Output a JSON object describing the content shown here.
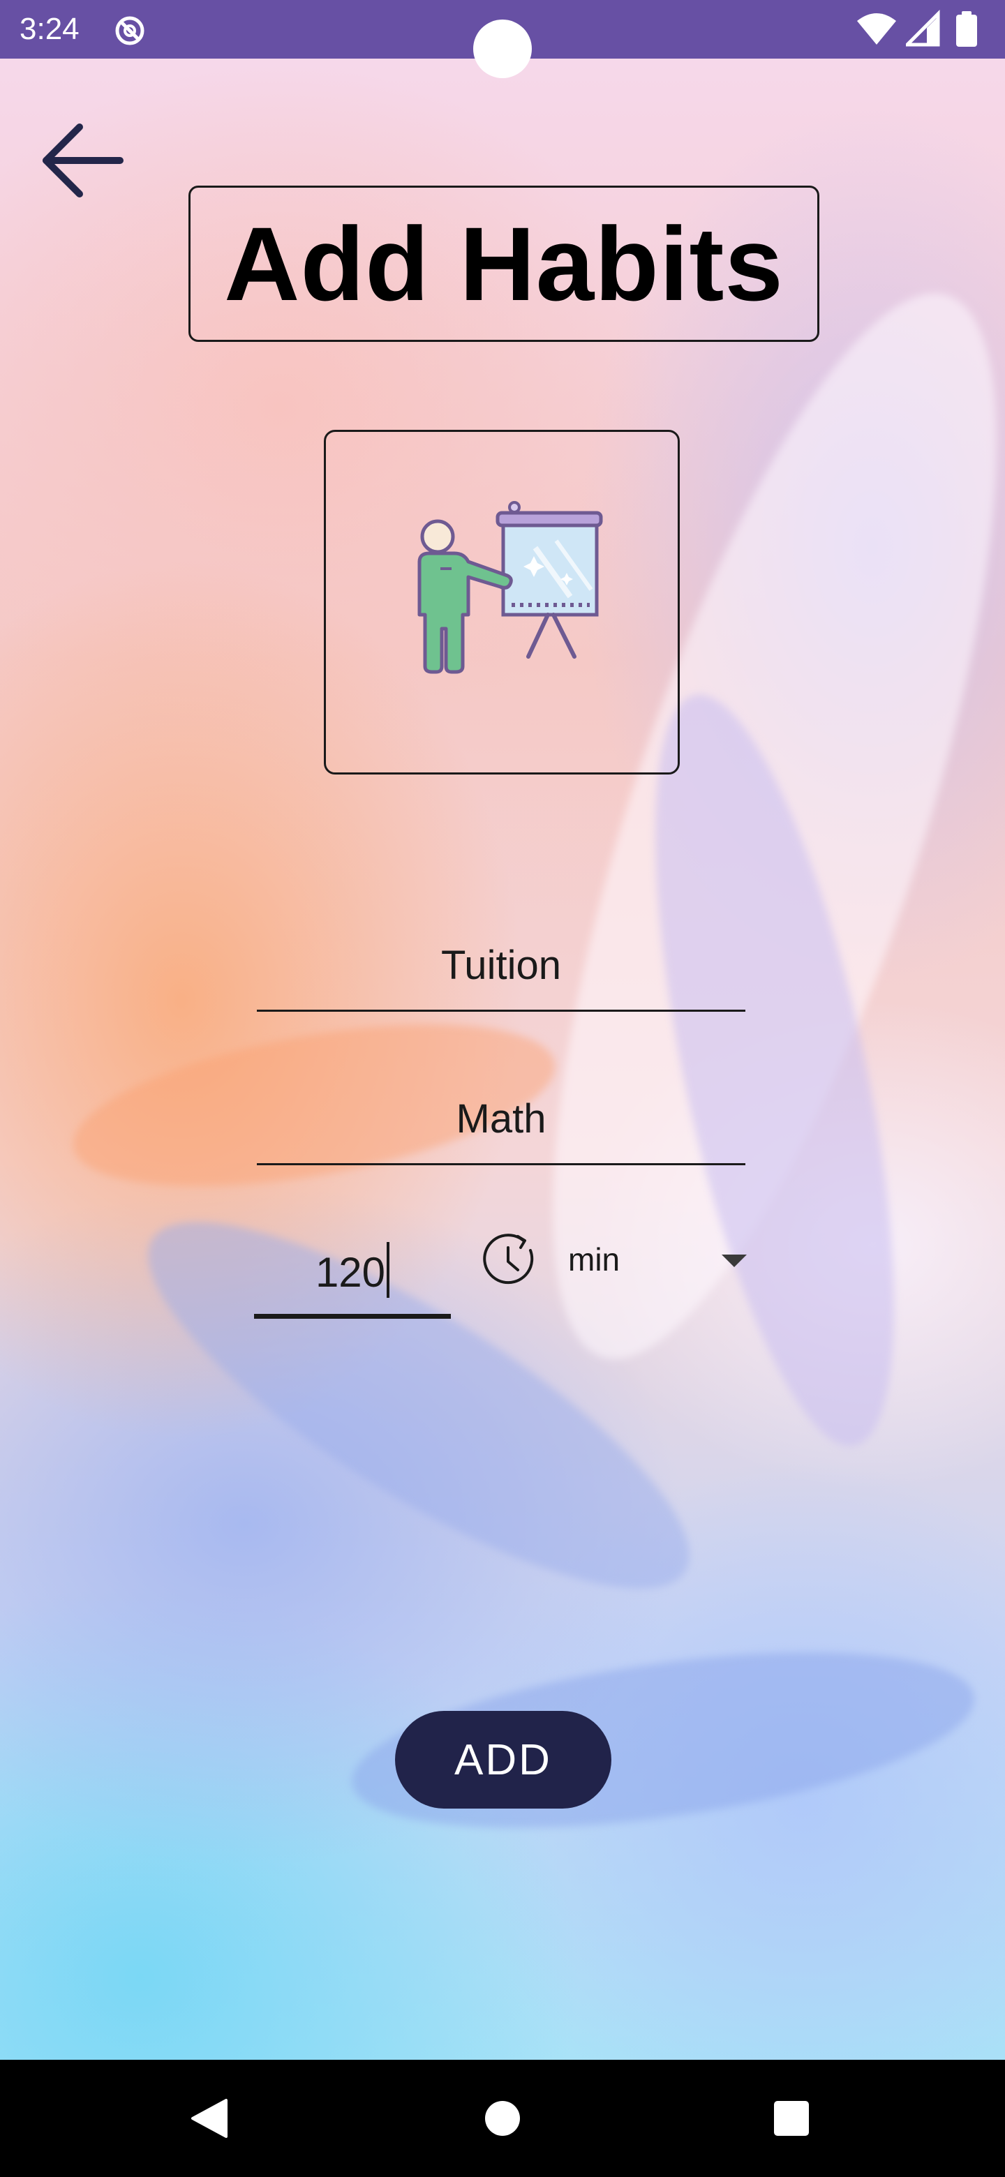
{
  "status_bar": {
    "time": "3:24",
    "app_icon": "no-disturb-icon",
    "icons": [
      "wifi-icon",
      "signal-icon",
      "battery-icon"
    ]
  },
  "header": {
    "back_icon": "arrow-back-icon",
    "title": "Add Habits"
  },
  "habit_image": {
    "icon": "teacher-presentation-icon"
  },
  "form": {
    "name_value": "Tuition",
    "description_value": "Math",
    "duration_value": "120",
    "unit_icon": "clock-timer-icon",
    "unit_selected": "min",
    "dropdown_icon": "dropdown-arrow-icon"
  },
  "actions": {
    "add_label": "ADD"
  },
  "navigation": {
    "back": "nav-back-icon",
    "home": "nav-home-icon",
    "recents": "nav-recents-icon"
  },
  "colors": {
    "status_bar": "#6750a4",
    "button": "#21234a",
    "nav_bar": "#000000"
  }
}
